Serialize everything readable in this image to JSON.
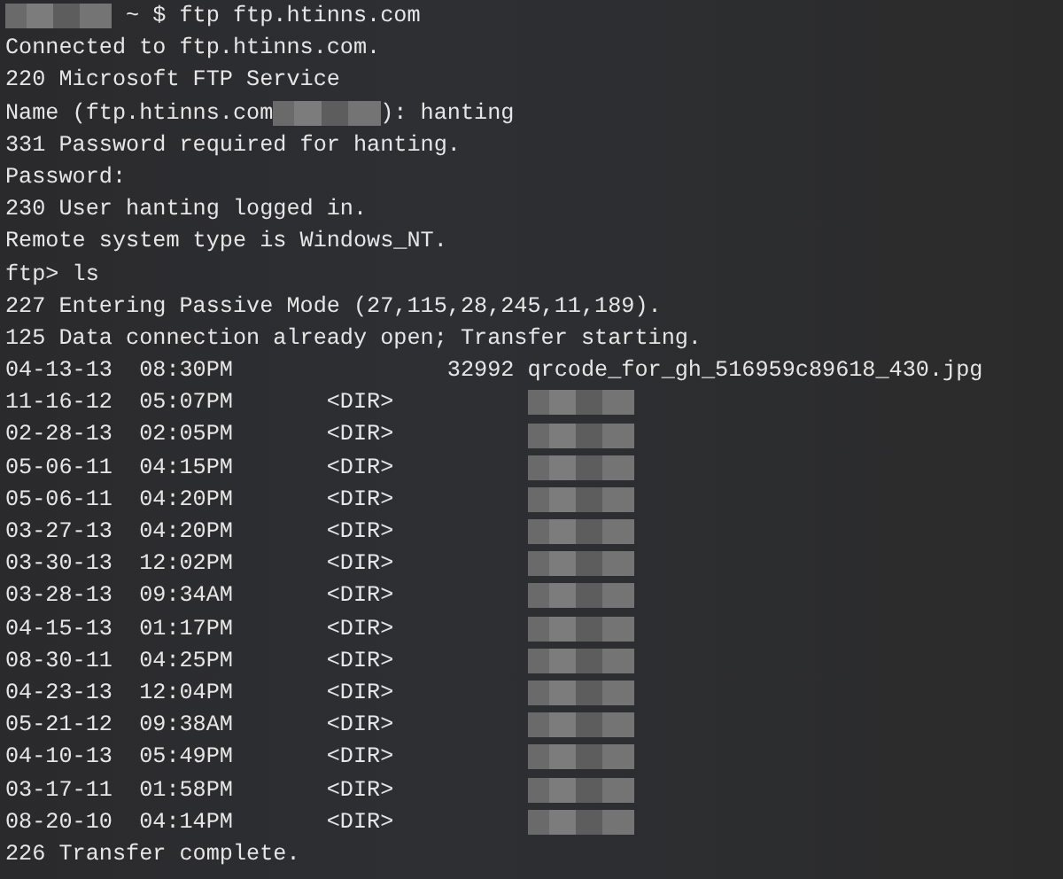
{
  "terminal": {
    "lines": [
      [
        {
          "kind": "redacted"
        },
        {
          "kind": "text",
          "text": " ~ $ ftp ftp.htinns.com"
        }
      ],
      [
        {
          "kind": "text",
          "text": "Connected to ftp.htinns.com."
        }
      ],
      [
        {
          "kind": "text",
          "text": "220 Microsoft FTP Service"
        }
      ],
      [
        {
          "kind": "text",
          "text": "Name (ftp.htinns.com"
        },
        {
          "kind": "redacted"
        },
        {
          "kind": "text",
          "text": "): hanting"
        }
      ],
      [
        {
          "kind": "text",
          "text": "331 Password required for hanting."
        }
      ],
      [
        {
          "kind": "text",
          "text": "Password:"
        }
      ],
      [
        {
          "kind": "text",
          "text": "230 User hanting logged in."
        }
      ],
      [
        {
          "kind": "text",
          "text": "Remote system type is Windows_NT."
        }
      ],
      [
        {
          "kind": "text",
          "text": "ftp> ls"
        }
      ],
      [
        {
          "kind": "text",
          "text": "227 Entering Passive Mode (27,115,28,245,11,189)."
        }
      ],
      [
        {
          "kind": "text",
          "text": "125 Data connection already open; Transfer starting."
        }
      ],
      [
        {
          "kind": "text",
          "text": "04-13-13  08:30PM                32992 qrcode_for_gh_516959c89618_430.jpg"
        }
      ],
      [
        {
          "kind": "text",
          "text": "11-16-12  05:07PM       <DIR>          "
        },
        {
          "kind": "redacted"
        }
      ],
      [
        {
          "kind": "text",
          "text": "02-28-13  02:05PM       <DIR>          "
        },
        {
          "kind": "redacted"
        }
      ],
      [
        {
          "kind": "text",
          "text": "05-06-11  04:15PM       <DIR>          "
        },
        {
          "kind": "redacted"
        }
      ],
      [
        {
          "kind": "text",
          "text": "05-06-11  04:20PM       <DIR>          "
        },
        {
          "kind": "redacted"
        }
      ],
      [
        {
          "kind": "text",
          "text": "03-27-13  04:20PM       <DIR>          "
        },
        {
          "kind": "redacted"
        }
      ],
      [
        {
          "kind": "text",
          "text": "03-30-13  12:02PM       <DIR>          "
        },
        {
          "kind": "redacted"
        }
      ],
      [
        {
          "kind": "text",
          "text": "03-28-13  09:34AM       <DIR>          "
        },
        {
          "kind": "redacted"
        }
      ],
      [
        {
          "kind": "text",
          "text": "04-15-13  01:17PM       <DIR>          "
        },
        {
          "kind": "redacted"
        }
      ],
      [
        {
          "kind": "text",
          "text": "08-30-11  04:25PM       <DIR>          "
        },
        {
          "kind": "redacted"
        }
      ],
      [
        {
          "kind": "text",
          "text": "04-23-13  12:04PM       <DIR>          "
        },
        {
          "kind": "redacted"
        }
      ],
      [
        {
          "kind": "text",
          "text": "05-21-12  09:38AM       <DIR>          "
        },
        {
          "kind": "redacted"
        }
      ],
      [
        {
          "kind": "text",
          "text": "04-10-13  05:49PM       <DIR>          "
        },
        {
          "kind": "redacted"
        }
      ],
      [
        {
          "kind": "text",
          "text": "03-17-11  01:58PM       <DIR>          "
        },
        {
          "kind": "redacted"
        }
      ],
      [
        {
          "kind": "text",
          "text": "08-20-10  04:14PM       <DIR>          "
        },
        {
          "kind": "redacted"
        }
      ],
      [
        {
          "kind": "text",
          "text": "226 Transfer complete."
        }
      ]
    ]
  }
}
